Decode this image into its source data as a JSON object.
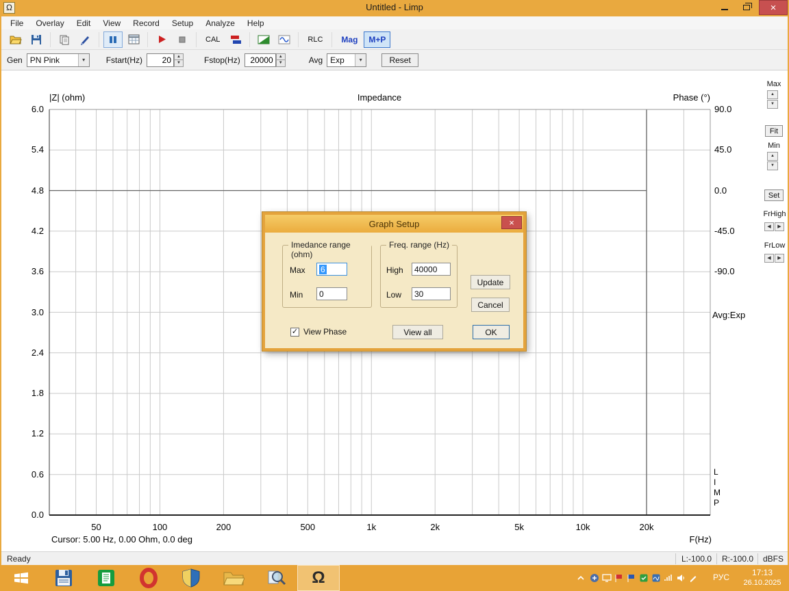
{
  "window": {
    "title": "Untitled - Limp",
    "icon_glyph": "Ω"
  },
  "menu": {
    "items": [
      "File",
      "Overlay",
      "Edit",
      "View",
      "Record",
      "Setup",
      "Analyze",
      "Help"
    ]
  },
  "toolbar": {
    "cal_label": "CAL",
    "rlc_label": "RLC",
    "mag_label": "Mag",
    "mp_label": "M+P"
  },
  "controls": {
    "gen_label": "Gen",
    "gen_value": "PN Pink",
    "fstart_label": "Fstart(Hz)",
    "fstart_value": "20",
    "fstop_label": "Fstop(Hz)",
    "fstop_value": "20000",
    "avg_label": "Avg",
    "avg_value": "Exp",
    "reset_label": "Reset"
  },
  "chart": {
    "title": "Impedance",
    "left_axis_title": "|Z| (ohm)",
    "right_axis_title": "Phase (°)",
    "x_axis_title": "F(Hz)",
    "cursor_readout": "Cursor: 5.00 Hz, 0.00 Ohm, 0.0 deg",
    "f_min": 30,
    "f_max": 40000,
    "z_min": 0.0,
    "z_max": 6.0,
    "left_ticks": [
      "6.0",
      "5.4",
      "4.8",
      "4.2",
      "3.6",
      "3.0",
      "2.4",
      "1.8",
      "1.2",
      "0.6",
      "0.0"
    ],
    "right_ticks": [
      "90.0",
      "45.0",
      "0.0",
      "-45.0",
      "-90.0"
    ],
    "x_ticks": [
      {
        "f": 50,
        "label": "50"
      },
      {
        "f": 100,
        "label": "100"
      },
      {
        "f": 200,
        "label": "200"
      },
      {
        "f": 500,
        "label": "500"
      },
      {
        "f": 1000,
        "label": "1k"
      },
      {
        "f": 2000,
        "label": "2k"
      },
      {
        "f": 5000,
        "label": "5k"
      },
      {
        "f": 10000,
        "label": "10k"
      },
      {
        "f": 20000,
        "label": "20k"
      }
    ],
    "marker_freq": 20000,
    "zero_phase_tick_index": 2
  },
  "side_panel": {
    "max_label": "Max",
    "fit_label": "Fit",
    "min_label": "Min",
    "set_label": "Set",
    "frhigh_label": "FrHigh",
    "frlow_label": "FrLow",
    "avg_readout": "Avg:Exp",
    "brand_vertical": [
      "L",
      "I",
      "M",
      "P"
    ]
  },
  "dialog": {
    "title": "Graph  Setup",
    "impedance_group_label": "Imedance range (ohm)",
    "max_label": "Max",
    "max_value": "6",
    "min_label": "Min",
    "min_value": "0",
    "freq_group_label": "Freq. range (Hz)",
    "high_label": "High",
    "high_value": "40000",
    "low_label": "Low",
    "low_value": "30",
    "update_label": "Update",
    "cancel_label": "Cancel",
    "ok_label": "OK",
    "view_phase_label": "View Phase",
    "view_all_label": "View all",
    "accent_color": "#E4A33C"
  },
  "status": {
    "ready": "Ready",
    "left_level": "L:-100.0",
    "right_level": "R:-100.0",
    "unit": "dBFS"
  },
  "taskbar": {
    "language": "РУС",
    "time": "17:13",
    "date": "26.10.2025"
  }
}
